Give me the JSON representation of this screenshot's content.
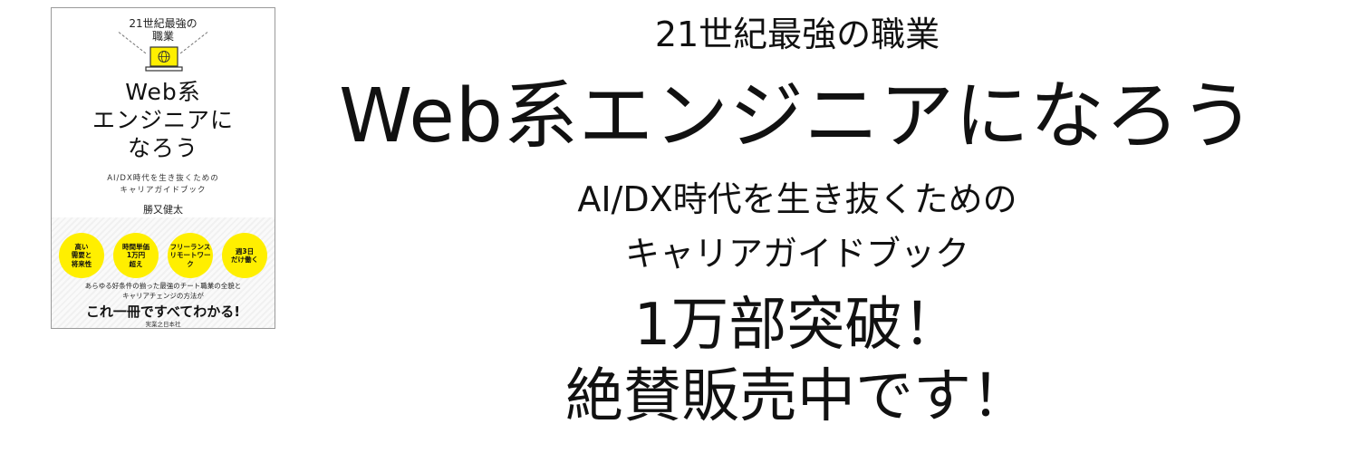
{
  "cover": {
    "kicker_line1": "21世紀最強の",
    "kicker_line2": "職業",
    "icon": "laptop-globe-icon",
    "title_line1": "Web系",
    "title_line2": "エンジニアに",
    "title_line3": "なろう",
    "subtitle_line1": "AI/DX時代を生き抜くための",
    "subtitle_line2": "キャリアガイドブック",
    "author": "勝又健太",
    "badges": [
      "高い\n需要と\n将来性",
      "時間単価\n1万円\n超え",
      "フリーランス\nリモートワーク",
      "週3日\nだけ働く"
    ],
    "blurb": "あらゆる好条件の揃った最強のチート職業の全貌と\nキャリアチェンジの方法が",
    "slogan": "これ一冊ですべてわかる!",
    "publisher": "実業之日本社",
    "badge_color": "#ffef00"
  },
  "headline": {
    "kicker": "21世紀最強の職業",
    "title": "Web系エンジニアになろう",
    "subtitle_line1": "AI/DX時代を生き抜くための",
    "subtitle_line2": "キャリアガイドブック",
    "milestone": "1万部突破！",
    "cta": "絶賛販売中です！"
  }
}
